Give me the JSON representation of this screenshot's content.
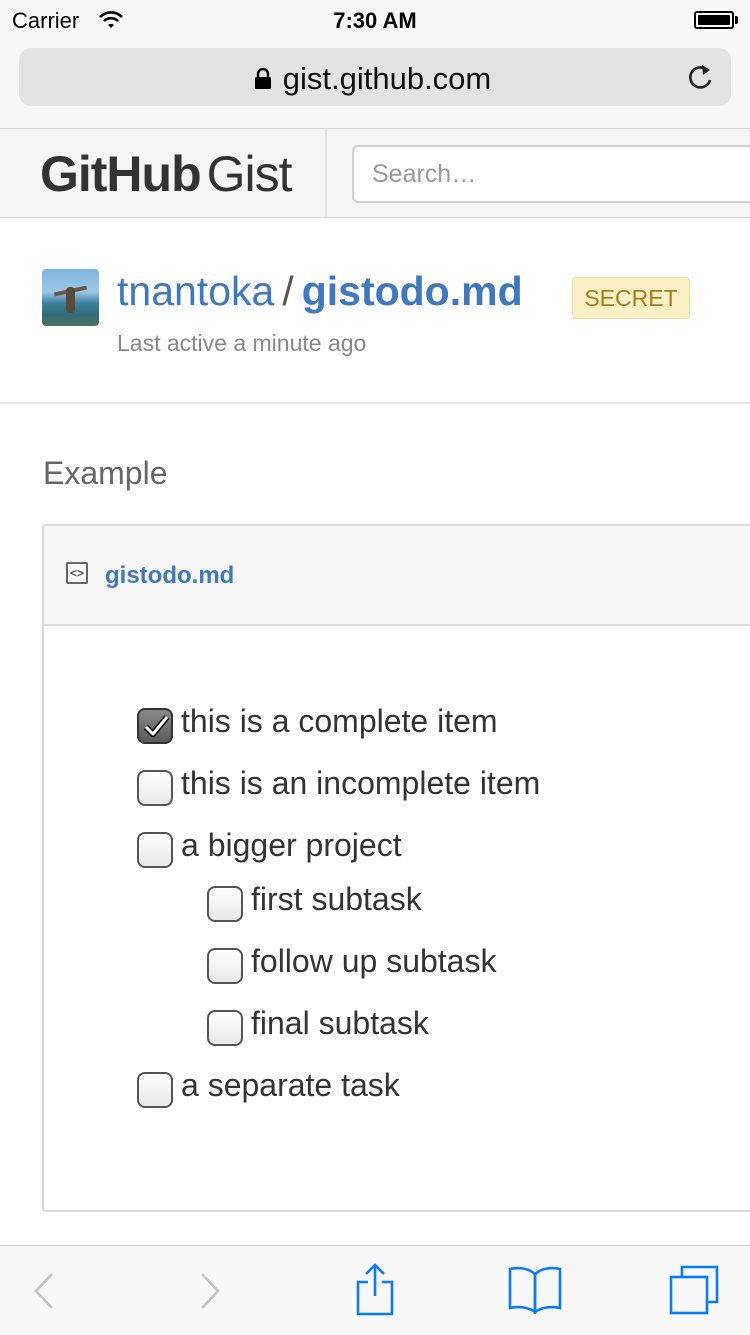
{
  "status_bar": {
    "carrier": "Carrier",
    "time": "7:30 AM",
    "wifi_icon": "wifi-icon",
    "battery_icon": "battery-icon"
  },
  "browser": {
    "url": "gist.github.com",
    "lock_icon": "lock-icon",
    "reload_icon": "reload-icon"
  },
  "header": {
    "logo_bold": "GitHub",
    "logo_light": "Gist",
    "search_placeholder": "Search…"
  },
  "gist": {
    "owner": "tnantoka",
    "separator": "/",
    "filename_title": "gistodo.md",
    "badge": "SECRET",
    "last_active": "Last active a minute ago",
    "description": "Example"
  },
  "file": {
    "icon": "code-file-icon",
    "icon_glyph": "<>",
    "name": "gistodo.md",
    "tasks": [
      {
        "label": "this is a complete item",
        "checked": true,
        "level": 0
      },
      {
        "label": "this is an incomplete item",
        "checked": false,
        "level": 0
      },
      {
        "label": "a bigger project",
        "checked": false,
        "level": 0
      },
      {
        "label": "first subtask",
        "checked": false,
        "level": 1
      },
      {
        "label": "follow up subtask",
        "checked": false,
        "level": 1
      },
      {
        "label": "final subtask",
        "checked": false,
        "level": 1
      },
      {
        "label": "a separate task",
        "checked": false,
        "level": 0
      }
    ]
  },
  "toolbar": {
    "items": [
      "back-icon",
      "forward-icon",
      "share-icon",
      "bookmarks-icon",
      "tabs-icon"
    ],
    "accent_color": "#0a7aff",
    "disabled_color": "#c4c4c4"
  }
}
